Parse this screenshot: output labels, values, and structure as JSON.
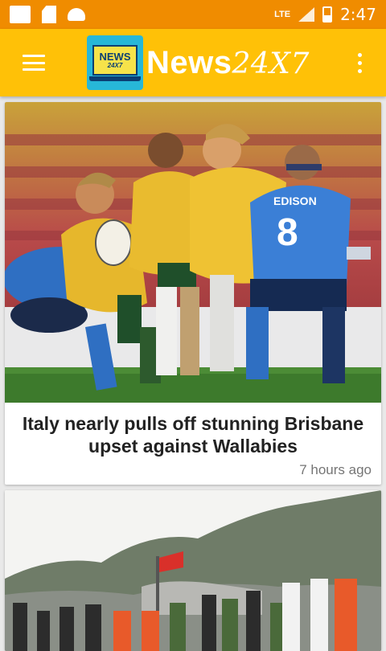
{
  "status_bar": {
    "network": "LTE",
    "time": "2:47"
  },
  "app_bar": {
    "logo_top": "NEWS",
    "logo_bottom": "24X7",
    "brand_main": "News",
    "brand_suffix": "24X7"
  },
  "articles": [
    {
      "title": "Italy nearly pulls off stunning Brisbane upset against Wallabies",
      "time_ago": "7 hours ago",
      "jersey_sponsor": "EDISON",
      "jersey_number": "8"
    },
    {
      "title": "",
      "time_ago": ""
    }
  ],
  "colors": {
    "status_bar": "#f08c00",
    "app_bar": "#ffc107",
    "card_bg": "#ffffff"
  },
  "icons": [
    "menu-icon",
    "logo-icon",
    "overflow-menu-icon",
    "sd-card-icon",
    "android-icon",
    "signal-icon",
    "battery-icon"
  ]
}
